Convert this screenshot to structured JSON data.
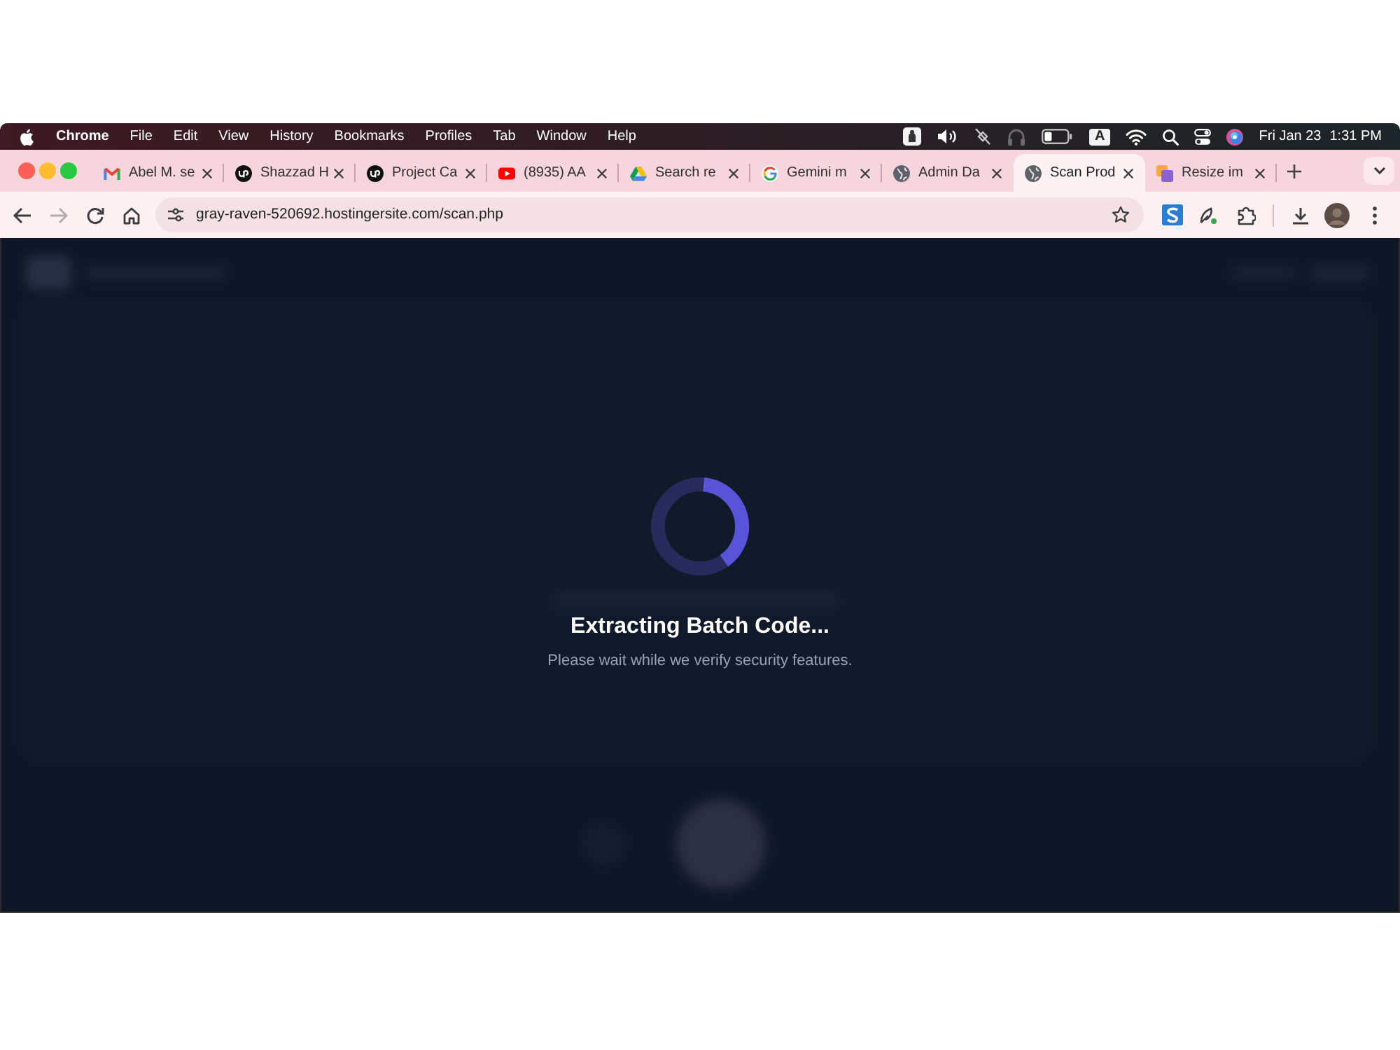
{
  "menu_bar": {
    "app_name": "Chrome",
    "menus": [
      "File",
      "Edit",
      "View",
      "History",
      "Bookmarks",
      "Profiles",
      "Tab",
      "Window",
      "Help"
    ],
    "input_source": "A",
    "date": "Fri Jan 23",
    "time": "1:31 PM"
  },
  "tabs": [
    {
      "title": "Abel M. se",
      "selected": false
    },
    {
      "title": "Shazzad H",
      "selected": false
    },
    {
      "title": "Project Ca",
      "selected": false
    },
    {
      "title": "(8935) AA",
      "selected": false
    },
    {
      "title": "Search re",
      "selected": false
    },
    {
      "title": "Gemini m",
      "selected": false
    },
    {
      "title": "Admin Da",
      "selected": false
    },
    {
      "title": "Scan Prod",
      "selected": true
    },
    {
      "title": "Resize im",
      "selected": false
    }
  ],
  "toolbar": {
    "url": "gray-raven-520692.hostingersite.com/scan.php",
    "forward_disabled": true
  },
  "page": {
    "title": "Extracting Batch Code...",
    "message": "Please wait while we verify security features."
  }
}
